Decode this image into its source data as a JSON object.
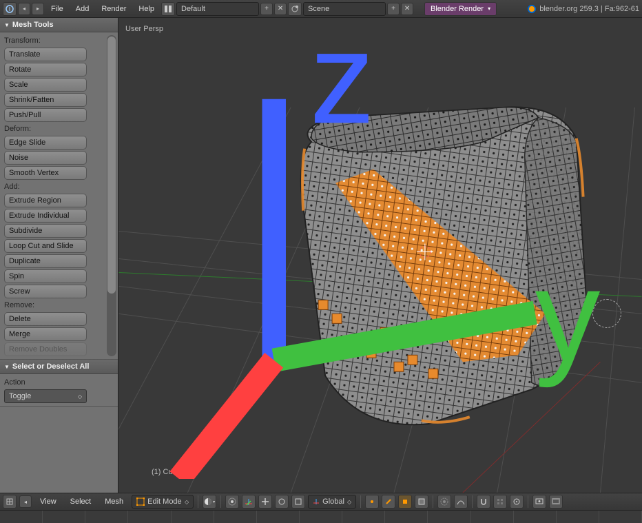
{
  "topbar": {
    "menus": [
      "File",
      "Add",
      "Render",
      "Help"
    ],
    "layout_dropdown": "Default",
    "scene_dropdown": "Scene",
    "engine_dropdown": "Blender Render",
    "status": "blender.org 259.3 | Fa:962-61"
  },
  "toolshelf": {
    "mesh_tools_header": "Mesh Tools",
    "transform_label": "Transform:",
    "transform": [
      "Translate",
      "Rotate",
      "Scale",
      "Shrink/Fatten",
      "Push/Pull"
    ],
    "deform_label": "Deform:",
    "deform": [
      "Edge Slide",
      "Noise",
      "Smooth Vertex"
    ],
    "add_label": "Add:",
    "add": [
      "Extrude Region",
      "Extrude Individual",
      "Subdivide",
      "Loop Cut and Slide",
      "Duplicate",
      "Spin",
      "Screw"
    ],
    "remove_label": "Remove:",
    "remove": [
      "Delete",
      "Merge",
      "Remove Doubles"
    ],
    "operator_header": "Select or Deselect All",
    "operator_action_label": "Action",
    "operator_action_value": "Toggle"
  },
  "viewport": {
    "persp_label": "User Persp",
    "object_label": "(1) Cube"
  },
  "header3d": {
    "menus": [
      "View",
      "Select",
      "Mesh"
    ],
    "mode": "Edit Mode",
    "orientation": "Global"
  }
}
